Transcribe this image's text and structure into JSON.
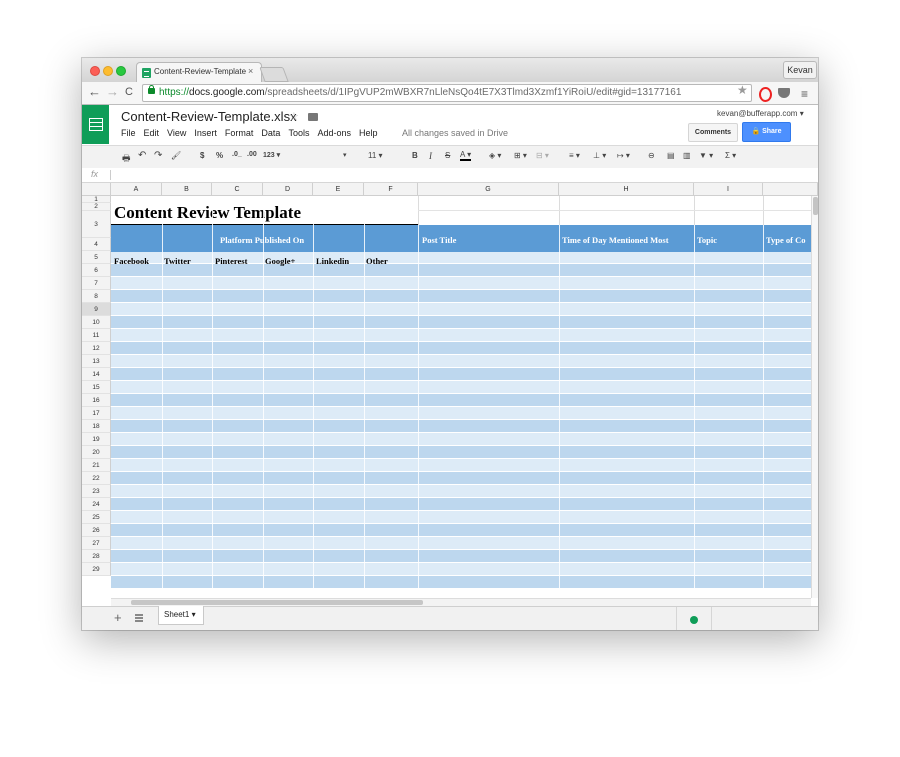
{
  "browser": {
    "tab_title": "Content-Review-Template.",
    "tab_close": "×",
    "user": "Kevan",
    "url_scheme": "https://",
    "url_domain": "docs.google.com",
    "url_path": "/spreadsheets/d/1IPgVUP2mWBXR7nLleNsQo4tE7X3Tlmd3Xzmf1YiRoiU/edit#gid=13177161",
    "back": "←",
    "forward": "→",
    "reload": "C",
    "star": "★",
    "menu": "≡"
  },
  "doc": {
    "title": "Content-Review-Template.xlsx",
    "star": "☆",
    "menu": [
      "File",
      "Edit",
      "View",
      "Insert",
      "Format",
      "Data",
      "Tools",
      "Add-ons",
      "Help"
    ],
    "saved_status": "All changes saved in Drive",
    "account": "kevan@bufferapp.com ▾",
    "comments_label": "Comments",
    "share_label": "🔒 Share",
    "sheet_name": "Sheet1 ▾"
  },
  "toolbar": {
    "print": "🖶",
    "undo": "↶",
    "redo": "↷",
    "paint": "🖌",
    "currency": "$",
    "percent": "%",
    "dec_less": ".0_",
    "dec_more": ".00",
    "format": "123 ▾",
    "font_dd": "▾",
    "font_size": "11 ▾",
    "bold": "B",
    "italic": "I",
    "strike": "S",
    "text_color": "A ▾",
    "fill": "◈ ▾",
    "borders": "⊞ ▾",
    "merge": "⊟ ▾",
    "halign": "≡ ▾",
    "valign": "⊥ ▾",
    "wrap": "↦ ▾",
    "link": "⊖",
    "comment": "▤",
    "chart": "▥",
    "filter": "▼ ▾",
    "functions": "Σ ▾"
  },
  "formula_bar": {
    "fx": "fx"
  },
  "columns": [
    "A",
    "B",
    "C",
    "D",
    "E",
    "F",
    "G",
    "H",
    "I",
    ""
  ],
  "rows": [
    "1",
    "2",
    "3",
    "4",
    "5",
    "6",
    "7",
    "8",
    "9",
    "10",
    "11",
    "12",
    "13",
    "14",
    "15",
    "16",
    "17",
    "18",
    "19",
    "20",
    "21",
    "22",
    "23",
    "24",
    "25",
    "26",
    "27",
    "28",
    "29"
  ],
  "selected_row": "9",
  "sheet": {
    "title": "Content Review Template",
    "platform_header": "Platform Published On",
    "platforms": [
      "Facebook",
      "Twitter",
      "Pinterest",
      "Google+",
      "Linkedin",
      "Other"
    ],
    "headers": [
      "Post Title",
      "Time of Day Mentioned Most",
      "Topic",
      "Type of Co"
    ]
  },
  "colors": {
    "header_blue": "#5b9bd5",
    "band_dark": "#bdd7ee",
    "band_light": "#ddebf7",
    "sheets_green": "#0f9d58",
    "share_blue": "#4d90fe"
  }
}
